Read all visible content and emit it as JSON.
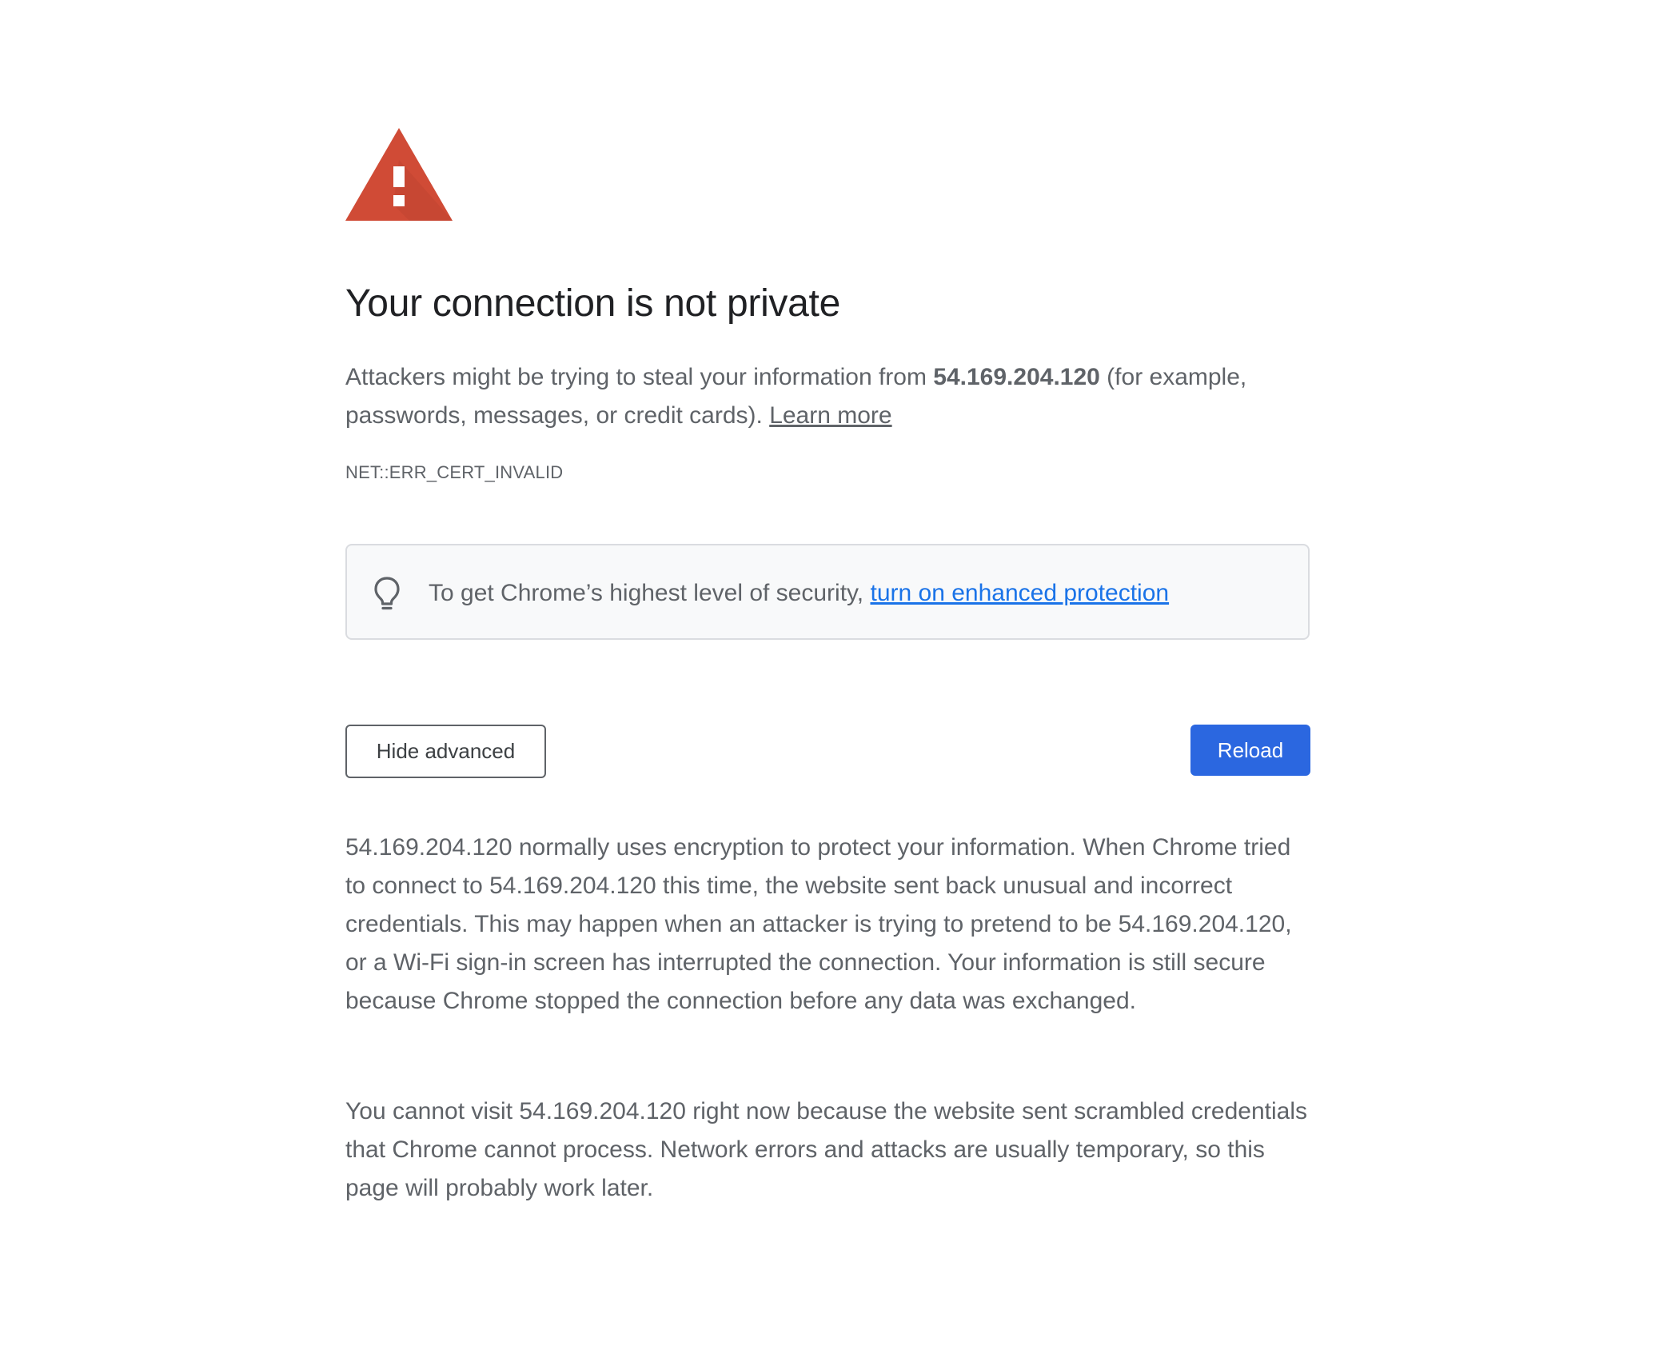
{
  "icons": {
    "warning": "warning-triangle-icon",
    "bulb": "lightbulb-icon"
  },
  "colors": {
    "warning_red": "#d04b36",
    "link_blue": "#1a73e8",
    "reload_blue": "#2b67e0",
    "title_text": "#202124",
    "body_text": "#5f6368",
    "box_bg": "#f8f9fa",
    "box_border": "#dadce0"
  },
  "heading": {
    "title": "Your connection is not private"
  },
  "intro": {
    "before_host": "Attackers might be trying to steal your information from ",
    "host": "54.169.204.120",
    "after_host": " (for example, passwords, messages, or credit cards). ",
    "learn_more": "Learn more"
  },
  "error_code": "NET::ERR_CERT_INVALID",
  "enhanced": {
    "text": "To get Chrome’s highest level of security, ",
    "link": "turn on enhanced protection"
  },
  "buttons": {
    "hide_advanced": "Hide advanced",
    "reload": "Reload"
  },
  "details": {
    "paragraph1": "54.169.204.120 normally uses encryption to protect your information. When Chrome tried to connect to 54.169.204.120 this time, the website sent back unusual and incorrect credentials. This may happen when an attacker is trying to pretend to be 54.169.204.120, or a Wi-Fi sign-in screen has interrupted the connection. Your information is still secure because Chrome stopped the connection before any data was exchanged.",
    "paragraph2": "You cannot visit 54.169.204.120 right now because the website sent scrambled credentials that Chrome cannot process. Network errors and attacks are usually temporary, so this page will probably work later."
  }
}
